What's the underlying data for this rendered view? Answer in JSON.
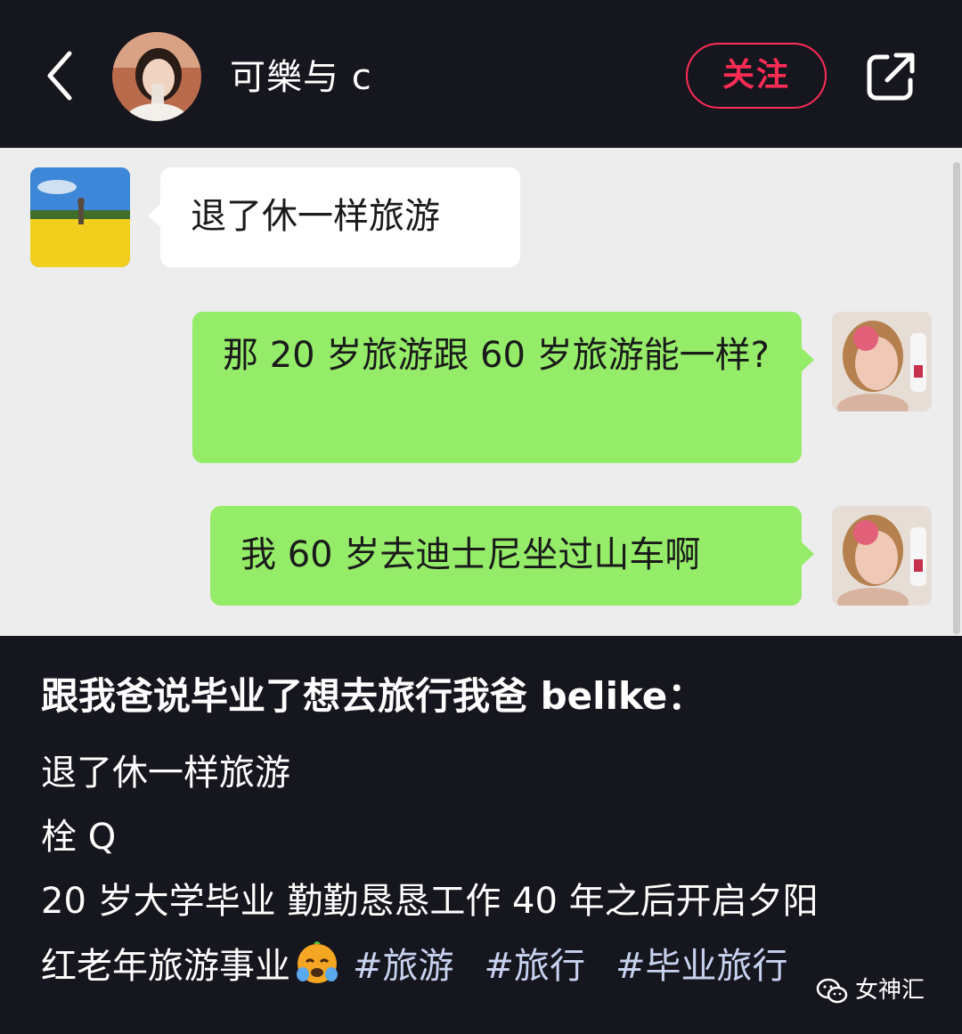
{
  "header": {
    "username": "可樂与 c",
    "follow_label": "关注",
    "icons": {
      "back": "back-chevron-icon",
      "share": "share-icon"
    },
    "accent_color": "#fe2c55"
  },
  "chat": {
    "messages": [
      {
        "side": "left",
        "text": "退了休一样旅游"
      },
      {
        "side": "right",
        "text": "那 20 岁旅游跟 60 岁旅游能一样?"
      },
      {
        "side": "right",
        "text": "我 60 岁去迪士尼坐过山车啊"
      }
    ],
    "colors": {
      "background": "#ededed",
      "sent_bubble": "#95ec69",
      "received_bubble": "#ffffff"
    }
  },
  "caption": {
    "title": "跟我爸说毕业了想去旅行我爸 belike：",
    "lines": [
      "退了休一样旅游",
      "栓 Q",
      "20 岁大学毕业 勤勤恳恳工作 40 年之后开启夕阳",
      "红老年旅游事业"
    ],
    "emoji": "crying-face-emoji",
    "hashtags": [
      "#旅游",
      "#旅行",
      "#毕业旅行"
    ]
  },
  "watermark": {
    "text": "女神汇",
    "icon": "wechat-icon"
  }
}
